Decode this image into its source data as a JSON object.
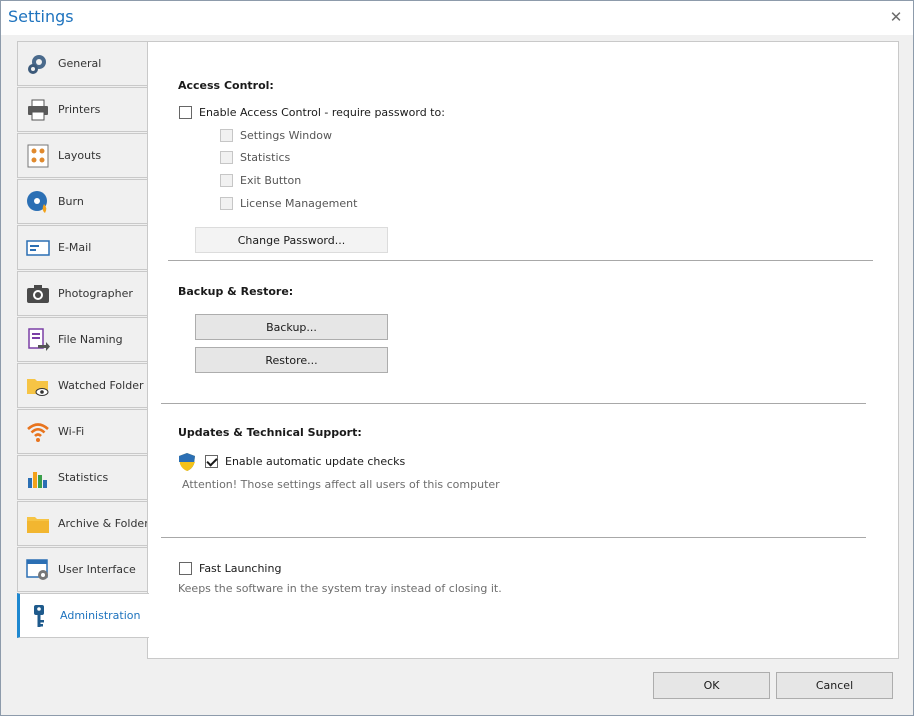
{
  "window": {
    "title": "Settings",
    "close_glyph": "✕"
  },
  "sidebar": {
    "items": [
      {
        "label": "General",
        "icon": "gear-icon"
      },
      {
        "label": "Printers",
        "icon": "printer-icon"
      },
      {
        "label": "Layouts",
        "icon": "layouts-icon"
      },
      {
        "label": "Burn",
        "icon": "disc-icon"
      },
      {
        "label": "E-Mail",
        "icon": "envelope-icon"
      },
      {
        "label": "Photographer",
        "icon": "camera-icon"
      },
      {
        "label": "File Naming",
        "icon": "file-rename-icon"
      },
      {
        "label": "Watched Folder",
        "icon": "watched-folder-icon"
      },
      {
        "label": "Wi-Fi",
        "icon": "wifi-icon"
      },
      {
        "label": "Statistics",
        "icon": "bar-chart-icon"
      },
      {
        "label": "Archive & Folders",
        "icon": "folder-icon"
      },
      {
        "label": "User Interface",
        "icon": "window-gear-icon"
      },
      {
        "label": "Administration",
        "icon": "key-icon",
        "active": true
      }
    ]
  },
  "access_control": {
    "title": "Access Control:",
    "enable_label": "Enable Access Control - require password to:",
    "enable_checked": false,
    "options": [
      {
        "label": "Settings Window",
        "checked": false,
        "disabled": true
      },
      {
        "label": "Statistics",
        "checked": false,
        "disabled": true
      },
      {
        "label": "Exit Button",
        "checked": false,
        "disabled": true
      },
      {
        "label": "License Management",
        "checked": false,
        "disabled": true
      }
    ],
    "change_password_label": "Change Password..."
  },
  "backup": {
    "title": "Backup & Restore:",
    "backup_label": "Backup...",
    "restore_label": "Restore..."
  },
  "updates": {
    "title": "Updates & Technical Support:",
    "auto_update_label": "Enable automatic update checks",
    "auto_update_checked": true,
    "attention_note": "Attention! Those settings affect all users of this computer"
  },
  "fast_launch": {
    "label": "Fast Launching",
    "checked": false,
    "note": "Keeps the software in the system tray instead of closing it."
  },
  "footer": {
    "ok_label": "OK",
    "cancel_label": "Cancel"
  },
  "colors": {
    "accent": "#1e73be",
    "active_border": "#1e88d0"
  }
}
